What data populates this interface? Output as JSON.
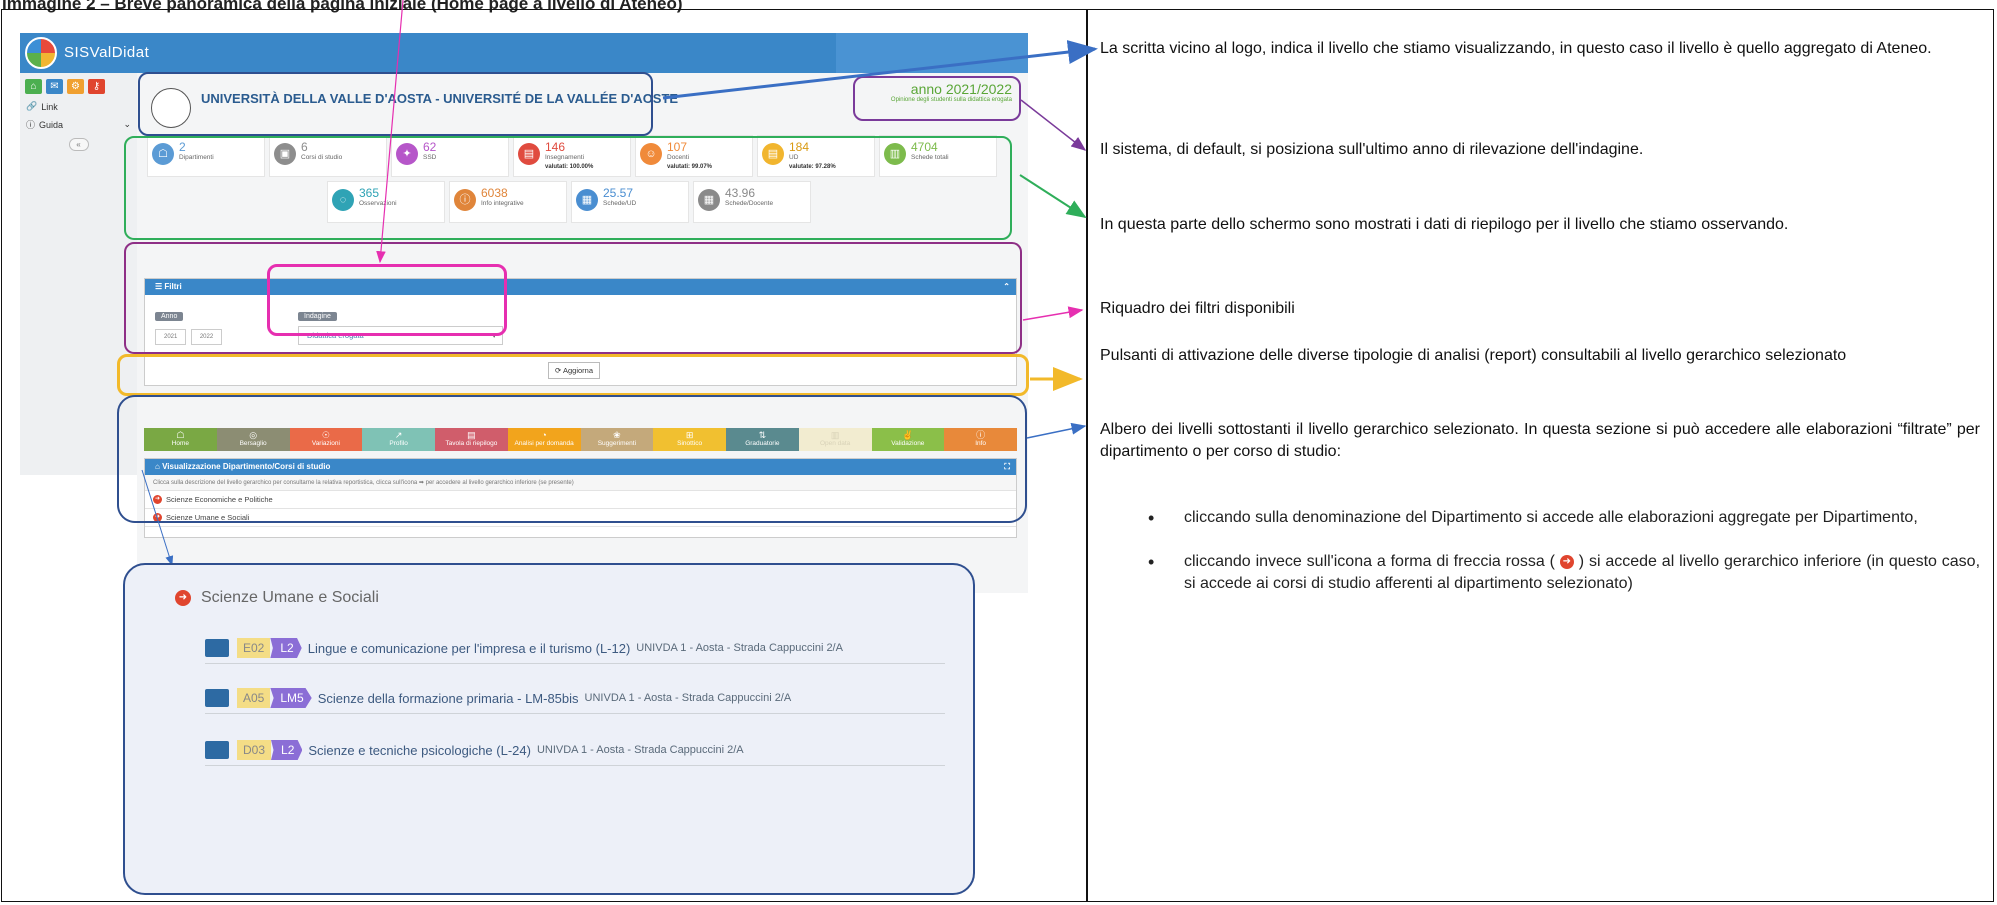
{
  "doc": {
    "title": "Immagine 2 – Breve panoramica della pagina iniziale (Home page a livello di Ateneo)"
  },
  "app": {
    "name": "SISValDidat",
    "sidebar": {
      "link_label": "Link",
      "guida_label": "Guida",
      "collapse_label": "«"
    },
    "university": "UNIVERSITÀ DELLA VALLE D'AOSTA - UNIVERSITÉ DE LA VALLÉE D'AOSTE",
    "anno_label": "anno 2021/2022",
    "anno_sub": "Opinione degli studenti sulla didattica erogata",
    "stats": [
      {
        "value": "2",
        "label": "Dipartimenti",
        "pct": "",
        "color": "#5b9bd5",
        "icon": "☖"
      },
      {
        "value": "6",
        "label": "Corsi di studio",
        "pct": "",
        "color": "#8d8d8d",
        "icon": "▣"
      },
      {
        "value": "62",
        "label": "SSD",
        "pct": "",
        "color": "#b656c9",
        "icon": "✦"
      },
      {
        "value": "146",
        "label": "Insegnamenti",
        "pct": "valutati: 100.00%",
        "color": "#e04b3f",
        "icon": "▤"
      },
      {
        "value": "107",
        "label": "Docenti",
        "pct": "valutati: 99.07%",
        "color": "#f08a3a",
        "icon": "☺"
      },
      {
        "value": "184",
        "label": "UD",
        "pct": "valutate: 97.28%",
        "color": "#f1b52e",
        "icon": "▤"
      },
      {
        "value": "4704",
        "label": "Schede totali",
        "pct": "",
        "color": "#7dbb4c",
        "icon": "▥"
      },
      {
        "value": "365",
        "label": "Osservazioni",
        "pct": "",
        "color": "#2fa3b5",
        "icon": "◌"
      },
      {
        "value": "6038",
        "label": "Info integrative",
        "pct": "",
        "color": "#e0853a",
        "icon": "ⓘ"
      },
      {
        "value": "25.57",
        "label": "Schede/UD",
        "pct": "",
        "color": "#4a8ed1",
        "icon": "▦"
      },
      {
        "value": "43.96",
        "label": "Schede/Docente",
        "pct": "",
        "color": "#8a8a8a",
        "icon": "▦"
      }
    ],
    "filters": {
      "title": "Filtri",
      "anno_chip": "Anno",
      "years": [
        "2021",
        "2022"
      ],
      "indagine_chip": "Indagine",
      "indagine_value": "Didattica erogata",
      "refresh_label": "Aggiorna"
    },
    "navbar": [
      {
        "label": "Home",
        "color": "#7aa844",
        "icon": "☖"
      },
      {
        "label": "Bersaglio",
        "color": "#8c8d73",
        "icon": "◎"
      },
      {
        "label": "Variazioni",
        "color": "#ea6a48",
        "icon": "☉"
      },
      {
        "label": "Profilo",
        "color": "#7fc2b5",
        "icon": "↗"
      },
      {
        "label": "Tavola di riepilogo",
        "color": "#d05d6b",
        "icon": "▤"
      },
      {
        "label": "Analisi per domanda",
        "color": "#f2a41c",
        "icon": "◔"
      },
      {
        "label": "Suggerimenti",
        "color": "#c4a97b",
        "icon": "❀"
      },
      {
        "label": "Sinottico",
        "color": "#f1c030",
        "icon": "⊞"
      },
      {
        "label": "Graduatorie",
        "color": "#5a8a8f",
        "icon": "⇅"
      },
      {
        "label": "Open data",
        "color": "#f2ecd0",
        "icon": "▥"
      },
      {
        "label": "Validazione",
        "color": "#8bbf49",
        "icon": "✌"
      },
      {
        "label": "Info",
        "color": "#e8893a",
        "icon": "ⓘ"
      }
    ],
    "tree": {
      "title": "Visualizzazione Dipartimento/Corsi di studio",
      "hint": "Clicca sulla descrizione del livello gerarchico per consultarne la relativa reportistica, clicca sull'icona ➡ per accedere al livello gerarchico inferiore (se presente)",
      "items": [
        "Scienze Economiche e Politiche",
        "Scienze Umane e Sociali"
      ]
    },
    "zoom": {
      "title": "Scienze Umane e Sociali",
      "rows": [
        {
          "code": "E02",
          "level": "L2",
          "name": "Lingue e comunicazione per l'impresa e il turismo (L-12)",
          "loc": "UNIVDA 1 - Aosta - Strada Cappuccini 2/A"
        },
        {
          "code": "A05",
          "level": "LM5",
          "name": "Scienze della formazione primaria - LM-85bis",
          "loc": "UNIVDA 1 - Aosta - Strada Cappuccini 2/A"
        },
        {
          "code": "D03",
          "level": "L2",
          "name": "Scienze e tecniche psicologiche (L-24)",
          "loc": "UNIVDA 1 - Aosta - Strada Cappuccini 2/A"
        }
      ]
    }
  },
  "notes": {
    "n1": "La scritta vicino al logo, indica il livello che stiamo visualizzando, in questo caso il livello è quello aggregato di Ateneo.",
    "n2": "Il sistema, di default, si posiziona sull'ultimo anno di rilevazione dell'indagine.",
    "n3": "In questa parte dello schermo sono mostrati i dati di riepilogo per il livello che stiamo osservando.",
    "n4": "Riquadro dei filtri disponibili",
    "n5": "Pulsanti di attivazione delle diverse tipologie di analisi (report) consultabili al livello gerarchico selezionato",
    "n6": "Albero dei livelli sottostanti il livello gerarchico selezionato. In questa sezione si può accedere alle elaborazioni “filtrate” per dipartimento o per corso di studio:",
    "b1": "cliccando sulla denominazione del Dipartimento si accede alle elaborazioni aggregate per Dipartimento,",
    "b2a": "cliccando invece sull'icona a forma di freccia rossa (",
    "b2b": ") si accede al livello gerarchico inferiore (in questo caso, si accede ai corsi di studio afferenti al dipartimento selezionato)"
  }
}
